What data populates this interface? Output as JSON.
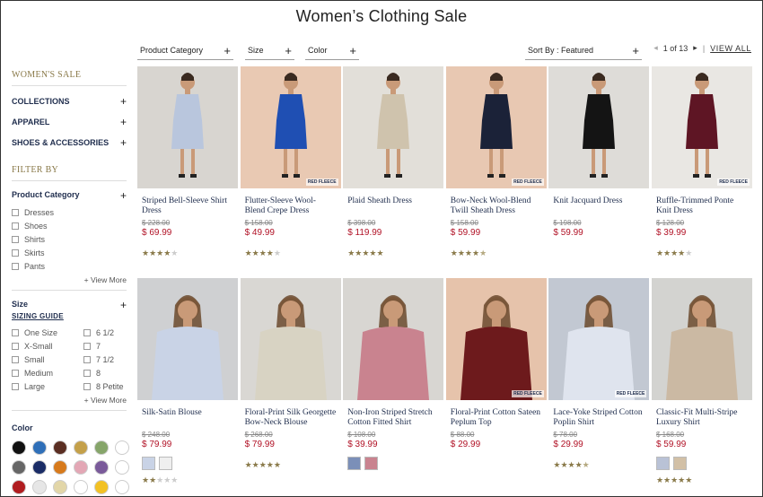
{
  "page_title": "Women’s Clothing Sale",
  "toolbar": {
    "product_category": "Product Category",
    "size": "Size",
    "color": "Color",
    "sort": "Sort By : Featured",
    "page_indicator": "1 of 13",
    "prev_icon": "◂",
    "next_icon": "▸",
    "view_all": "VIEW ALL"
  },
  "sidebar": {
    "section_title": "WOMEN'S SALE",
    "nav": [
      {
        "label": "COLLECTIONS"
      },
      {
        "label": "APPAREL"
      },
      {
        "label": "SHOES & ACCESSORIES"
      }
    ],
    "filter_title": "FILTER BY",
    "product_category": {
      "title": "Product Category",
      "options": [
        "Dresses",
        "Shoes",
        "Shirts",
        "Skirts",
        "Pants"
      ],
      "view_more": "+ View More"
    },
    "size": {
      "title": "Size",
      "sizing_guide": "SIZING GUIDE",
      "options_left": [
        "One Size",
        "X-Small",
        "Small",
        "Medium",
        "Large"
      ],
      "options_right": [
        "6 1/2",
        "7",
        "7 1/2",
        "8",
        "8 Petite"
      ],
      "view_more": "+ View More"
    },
    "color": {
      "title": "Color",
      "swatches": [
        "#111111",
        "#2f6fb8",
        "#5a2e22",
        "#c4a04a",
        "#86a56a",
        "#ffffff",
        "#666666",
        "#1a2c66",
        "#d77a1c",
        "#e3a7b5",
        "#7a5a9a",
        "#ffffff",
        "#b01d20",
        "#e6e6e6",
        "#e2d6a8",
        "#ffffff",
        "#f2c124",
        "#ffffff"
      ]
    }
  },
  "products": [
    {
      "name": "Striped Bell-Sleeve Shirt Dress",
      "old_price": "$ 228.00",
      "price": "$ 69.99",
      "stars": 4,
      "bg": "#d8d5d0",
      "garment": "#b9c6dd",
      "brand": ""
    },
    {
      "name": "Flutter-Sleeve Wool-Blend Crepe Dress",
      "old_price": "$ 158.00",
      "price": "$ 49.99",
      "stars": 4,
      "bg": "#e9c9b3",
      "garment": "#1f4fb3",
      "brand": "RED FLEECE"
    },
    {
      "name": "Plaid Sheath Dress",
      "old_price": "$ 398.00",
      "price": "$ 119.99",
      "stars": 5,
      "bg": "#e2dfd9",
      "garment": "#cfc3ad",
      "brand": ""
    },
    {
      "name": "Bow-Neck Wool-Blend Twill Sheath Dress",
      "old_price": "$ 158.00",
      "price": "$ 59.99",
      "stars": 4.5,
      "bg": "#e8c8b2",
      "garment": "#1b2238",
      "brand": "RED FLEECE"
    },
    {
      "name": "Knit Jacquard Dress",
      "old_price": "$ 198.00",
      "price": "$ 59.99",
      "stars": 0,
      "bg": "#dedcd8",
      "garment": "#141414",
      "brand": ""
    },
    {
      "name": "Ruffle-Trimmed Ponte Knit Dress",
      "old_price": "$ 128.00",
      "price": "$ 39.99",
      "stars": 4,
      "bg": "#e9e7e3",
      "garment": "#5e1524",
      "brand": "RED FLEECE"
    },
    {
      "name": "Silk-Satin Blouse",
      "old_price": "$ 248.00",
      "price": "$ 79.99",
      "stars": 2,
      "bg": "#cfd0d2",
      "garment": "#c9d3e6",
      "brand": "",
      "thumbs": [
        "#c9d3e6",
        "#efefef"
      ]
    },
    {
      "name": "Floral-Print Silk Georgette Bow-Neck Blouse",
      "old_price": "$ 268.00",
      "price": "$ 79.99",
      "stars": 5,
      "bg": "#d9d7d3",
      "garment": "#d8d3c3",
      "brand": ""
    },
    {
      "name": "Non-Iron Striped Stretch Cotton Fitted Shirt",
      "old_price": "$ 108.00",
      "price": "$ 39.99",
      "stars": 0,
      "bg": "#d8d6d2",
      "garment": "#c9838f",
      "brand": "",
      "thumbs": [
        "#7b8fb8",
        "#c9838f"
      ]
    },
    {
      "name": "Floral-Print Cotton Sateen Peplum Top",
      "old_price": "$ 88.00",
      "price": "$ 29.99",
      "stars": 0,
      "bg": "#e6c3ab",
      "garment": "#6d1a1c",
      "brand": "RED FLEECE"
    },
    {
      "name": "Lace-Yoke Striped Cotton Poplin Shirt",
      "old_price": "$ 78.00",
      "price": "$ 29.99",
      "stars": 4.5,
      "bg": "#c2c8d2",
      "garment": "#dfe4ee",
      "brand": "RED FLEECE"
    },
    {
      "name": "Classic-Fit Multi-Stripe Luxury Shirt",
      "old_price": "$ 168.00",
      "price": "$ 59.99",
      "stars": 5,
      "bg": "#d3d3d0",
      "garment": "#cbb9a3",
      "brand": "",
      "thumbs": [
        "#b9c2d6",
        "#d2c0a6"
      ]
    }
  ]
}
